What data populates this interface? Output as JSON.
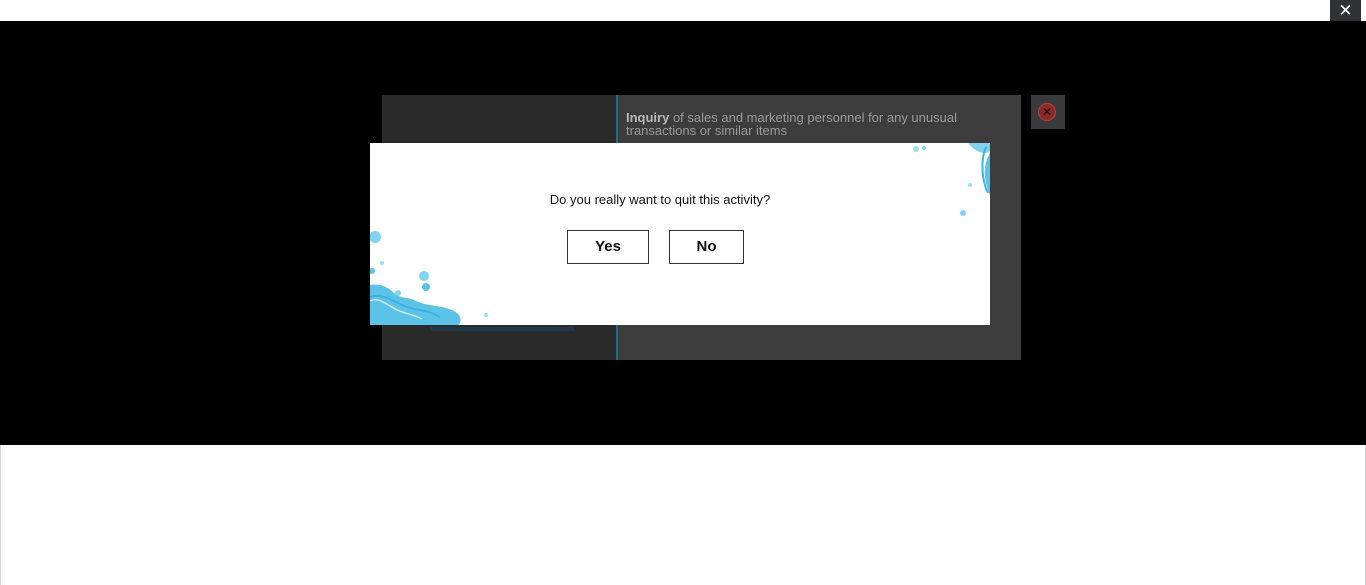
{
  "window": {
    "close_glyph": "✕",
    "close_icon": "close-icon"
  },
  "activity": {
    "bold_term": "Inquiry",
    "description": " of sales and marketing personnel for any unusual transactions or similar items",
    "close_icon": "close-circle-icon",
    "close_glyph": "✕"
  },
  "dialog": {
    "message": "Do you really want to quit this activity?",
    "yes_label": "Yes",
    "no_label": "No",
    "accent_color": "#5bc3e8"
  }
}
